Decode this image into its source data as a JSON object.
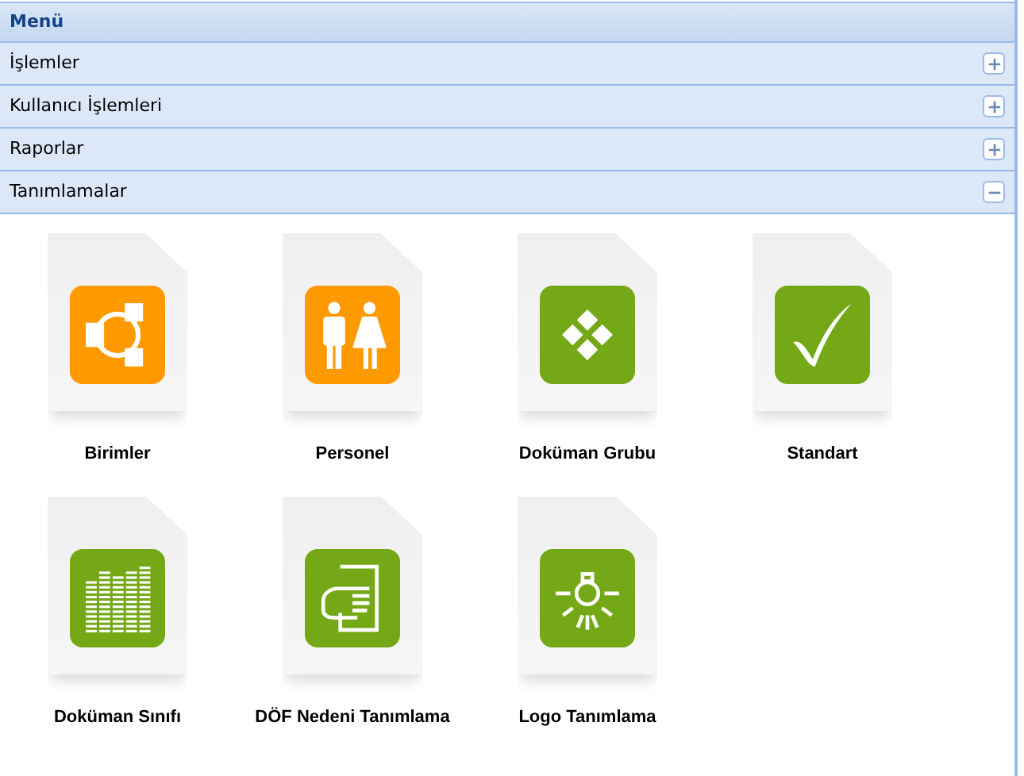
{
  "panel": {
    "title": "Menü"
  },
  "sections": [
    {
      "label": "İşlemler",
      "expanded": false
    },
    {
      "label": "Kullanıcı İşlemleri",
      "expanded": false
    },
    {
      "label": "Raporlar",
      "expanded": false
    },
    {
      "label": "Tanımlamalar",
      "expanded": true
    }
  ],
  "tiles": [
    {
      "label": "Birimler",
      "kind": "network",
      "color": "#ff9900"
    },
    {
      "label": "Personel",
      "kind": "people",
      "color": "#ff9900"
    },
    {
      "label": "Doküman Grubu",
      "kind": "diamonds",
      "color": "#75a816"
    },
    {
      "label": "Standart",
      "kind": "check",
      "color": "#75a816"
    },
    {
      "label": "Doküman Sınıfı",
      "kind": "bars",
      "color": "#75a816"
    },
    {
      "label": "DÖF Nedeni Tanımlama",
      "kind": "hand",
      "color": "#75a816"
    },
    {
      "label": "Logo Tanımlama",
      "kind": "bulb",
      "color": "#75a816"
    }
  ]
}
